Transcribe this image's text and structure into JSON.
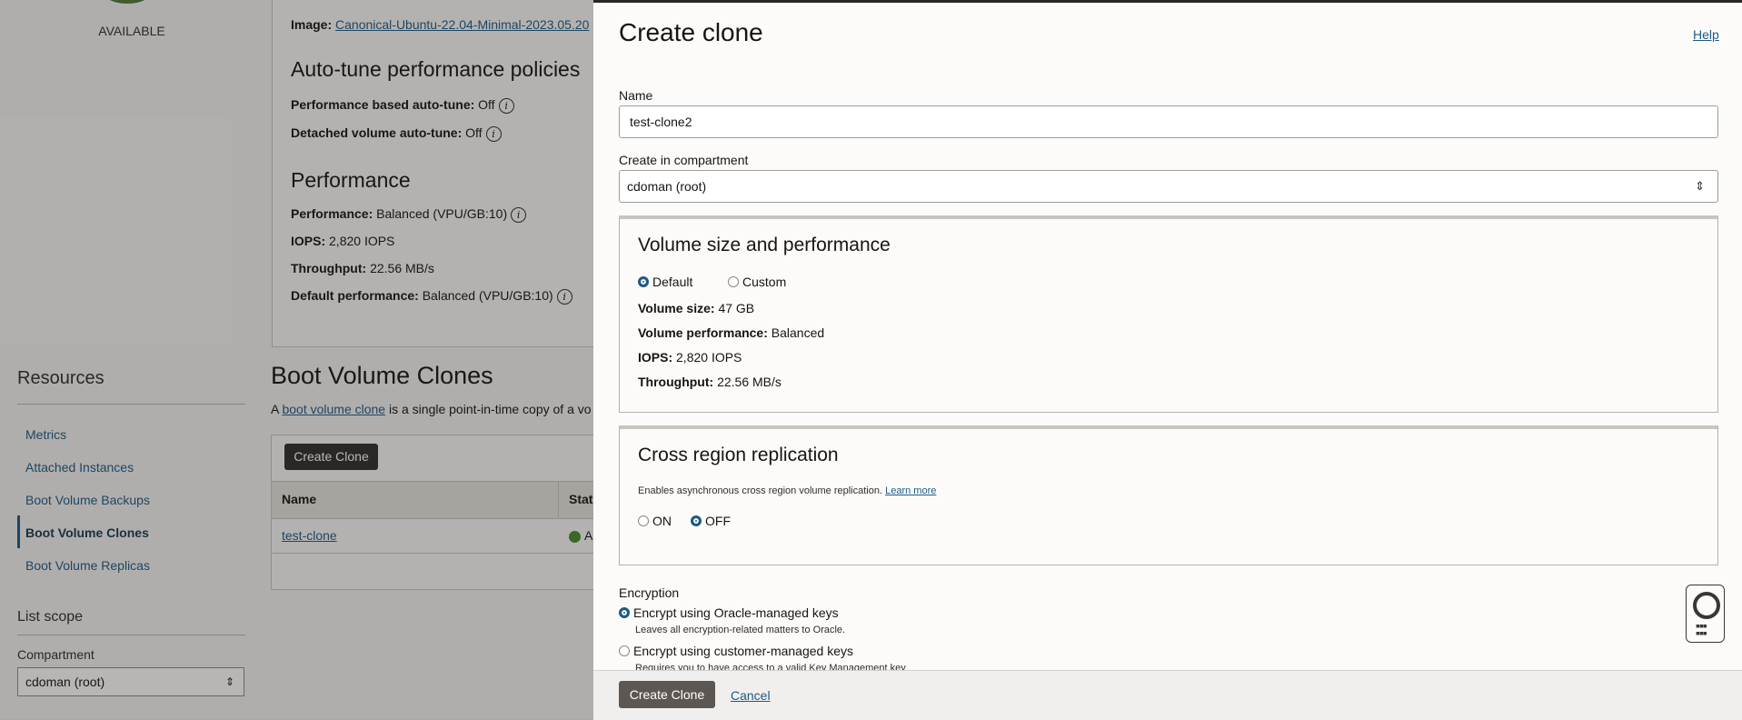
{
  "background": {
    "status": "AVAILABLE",
    "details": {
      "image_label": "Image:",
      "image_value": "Canonical-Ubuntu-22.04-Minimal-2023.05.20",
      "autotune_title": "Auto-tune performance policies",
      "perf_autotune_label": "Performance based auto-tune:",
      "perf_autotune_value": "Off",
      "detached_autotune_label": "Detached volume auto-tune:",
      "detached_autotune_value": "Off",
      "performance_title": "Performance",
      "performance_label": "Performance:",
      "performance_value": "Balanced (VPU/GB:10)",
      "iops_label": "IOPS:",
      "iops_value": "2,820 IOPS",
      "throughput_label": "Throughput:",
      "throughput_value": "22.56 MB/s",
      "default_perf_label": "Default performance:",
      "default_perf_value": "Balanced (VPU/GB:10)"
    },
    "resources": {
      "title": "Resources",
      "items": [
        {
          "label": "Metrics"
        },
        {
          "label": "Attached Instances"
        },
        {
          "label": "Boot Volume Backups"
        },
        {
          "label": "Boot Volume Clones"
        },
        {
          "label": "Boot Volume Replicas"
        }
      ]
    },
    "list_scope": {
      "title": "List scope",
      "compartment_label": "Compartment",
      "compartment_value": "cdoman (root)"
    },
    "clones": {
      "title": "Boot Volume Clones",
      "desc_prefix": "A ",
      "desc_link": "boot volume clone",
      "desc_suffix": " is a single point-in-time copy of a vo",
      "create_button": "Create Clone",
      "col_name": "Name",
      "col_status": "Stat",
      "row_name": "test-clone",
      "row_status": "A"
    }
  },
  "panel": {
    "title": "Create clone",
    "help": "Help",
    "name_label": "Name",
    "name_value": "test-clone2",
    "compartment_label": "Create in compartment",
    "compartment_value": "cdoman (root)",
    "volume": {
      "title": "Volume size and performance",
      "opt_default": "Default",
      "opt_custom": "Custom",
      "size_label": "Volume size:",
      "size_value": "47 GB",
      "perf_label": "Volume performance:",
      "perf_value": "Balanced",
      "iops_label": "IOPS:",
      "iops_value": "2,820 IOPS",
      "throughput_label": "Throughput:",
      "throughput_value": "22.56 MB/s"
    },
    "replication": {
      "title": "Cross region replication",
      "desc": "Enables asynchronous cross region volume replication.",
      "learn_more": "Learn more",
      "on": "ON",
      "off": "OFF"
    },
    "encryption": {
      "title": "Encryption",
      "opt_oracle": "Encrypt using Oracle-managed keys",
      "opt_oracle_desc": "Leaves all encryption-related matters to Oracle.",
      "opt_customer": "Encrypt using customer-managed keys",
      "opt_customer_desc": "Requires you to have access to a valid Key Management key"
    },
    "footer": {
      "create": "Create Clone",
      "cancel": "Cancel"
    }
  }
}
